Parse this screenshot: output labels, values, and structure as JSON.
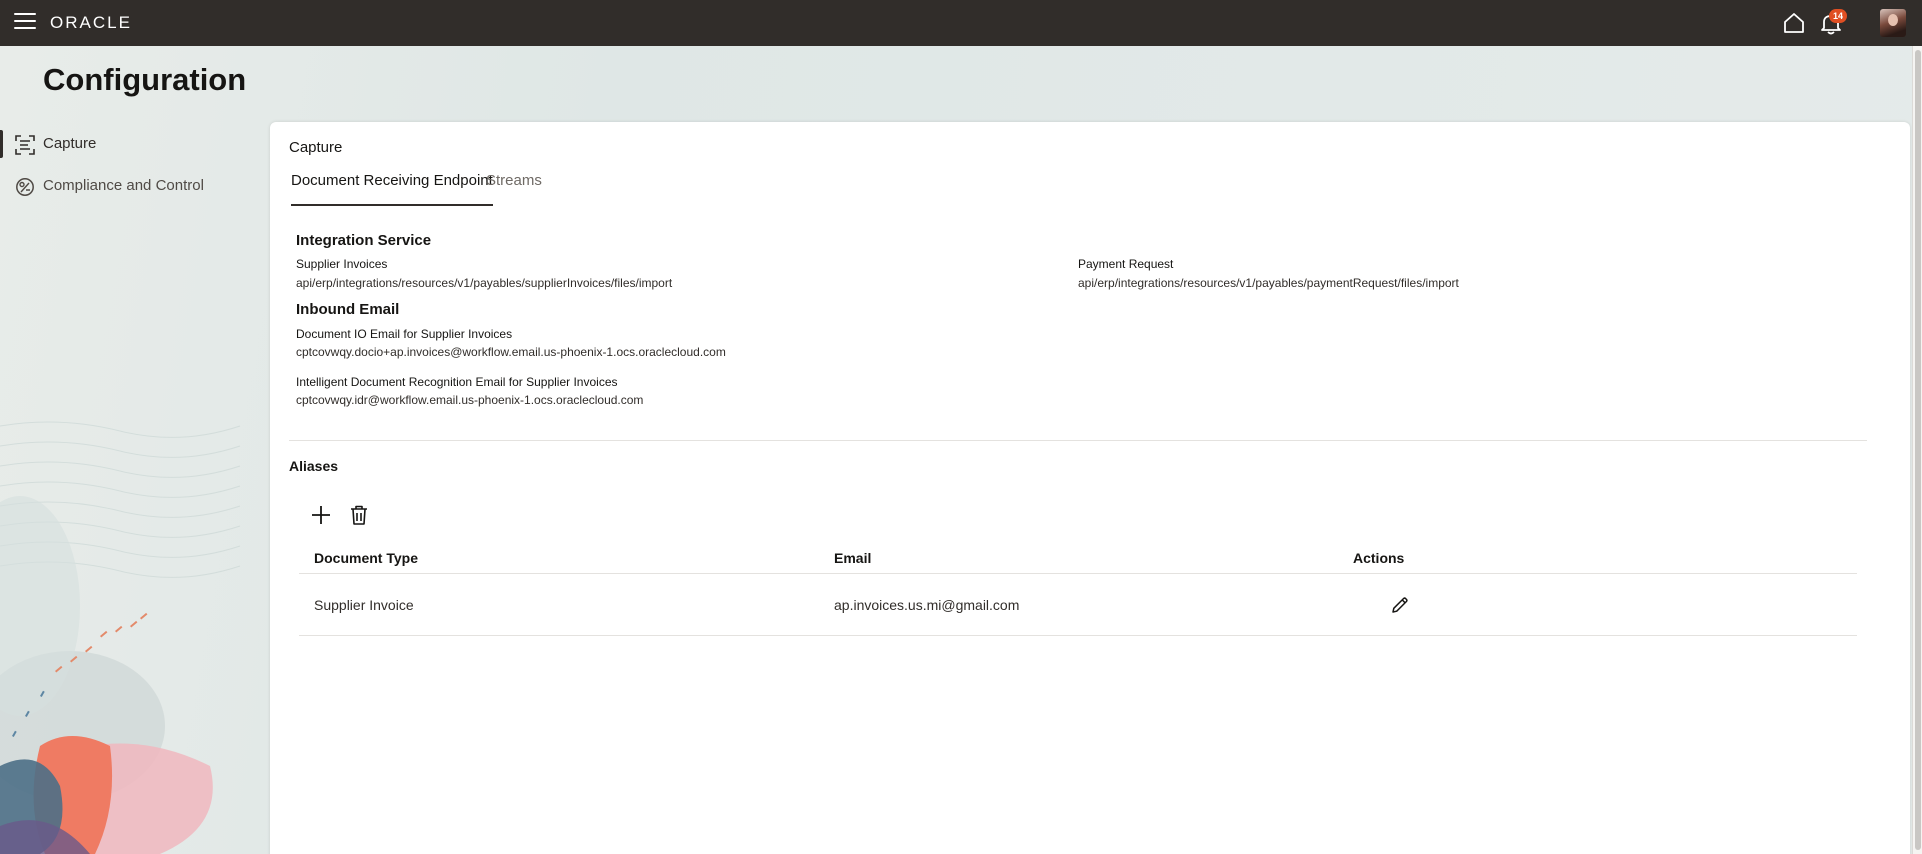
{
  "header": {
    "logo": "ORACLE",
    "notifications_count": "14"
  },
  "page": {
    "title": "Configuration"
  },
  "sidebar": {
    "items": [
      {
        "label": "Capture",
        "icon": "capture-icon",
        "active": true
      },
      {
        "label": "Compliance and Control",
        "icon": "compliance-icon",
        "active": false
      }
    ]
  },
  "panel": {
    "title": "Capture",
    "tabs": [
      {
        "label": "Document Receiving Endpoint",
        "active": true
      },
      {
        "label": "Streams",
        "active": false
      }
    ],
    "integration": {
      "title": "Integration Service",
      "supplier_label": "Supplier Invoices",
      "supplier_value": "api/erp/integrations/resources/v1/payables/supplierInvoices/files/import",
      "payment_label": "Payment Request",
      "payment_value": "api/erp/integrations/resources/v1/payables/paymentRequest/files/import"
    },
    "inbound": {
      "title": "Inbound Email",
      "docio_label": "Document IO Email for Supplier Invoices",
      "docio_value": "cptcovwqy.docio+ap.invoices@workflow.email.us-phoenix-1.ocs.oraclecloud.com",
      "idr_label": "Intelligent Document Recognition Email for Supplier Invoices",
      "idr_value": "cptcovwqy.idr@workflow.email.us-phoenix-1.ocs.oraclecloud.com"
    },
    "aliases": {
      "title": "Aliases",
      "columns": [
        "Document Type",
        "Email",
        "Actions"
      ],
      "rows": [
        {
          "document_type": "Supplier Invoice",
          "email": "ap.invoices.us.mi@gmail.com"
        }
      ]
    }
  },
  "colors": {
    "topbar": "#312d2a",
    "badge": "#e04f23",
    "text": "#161513"
  }
}
